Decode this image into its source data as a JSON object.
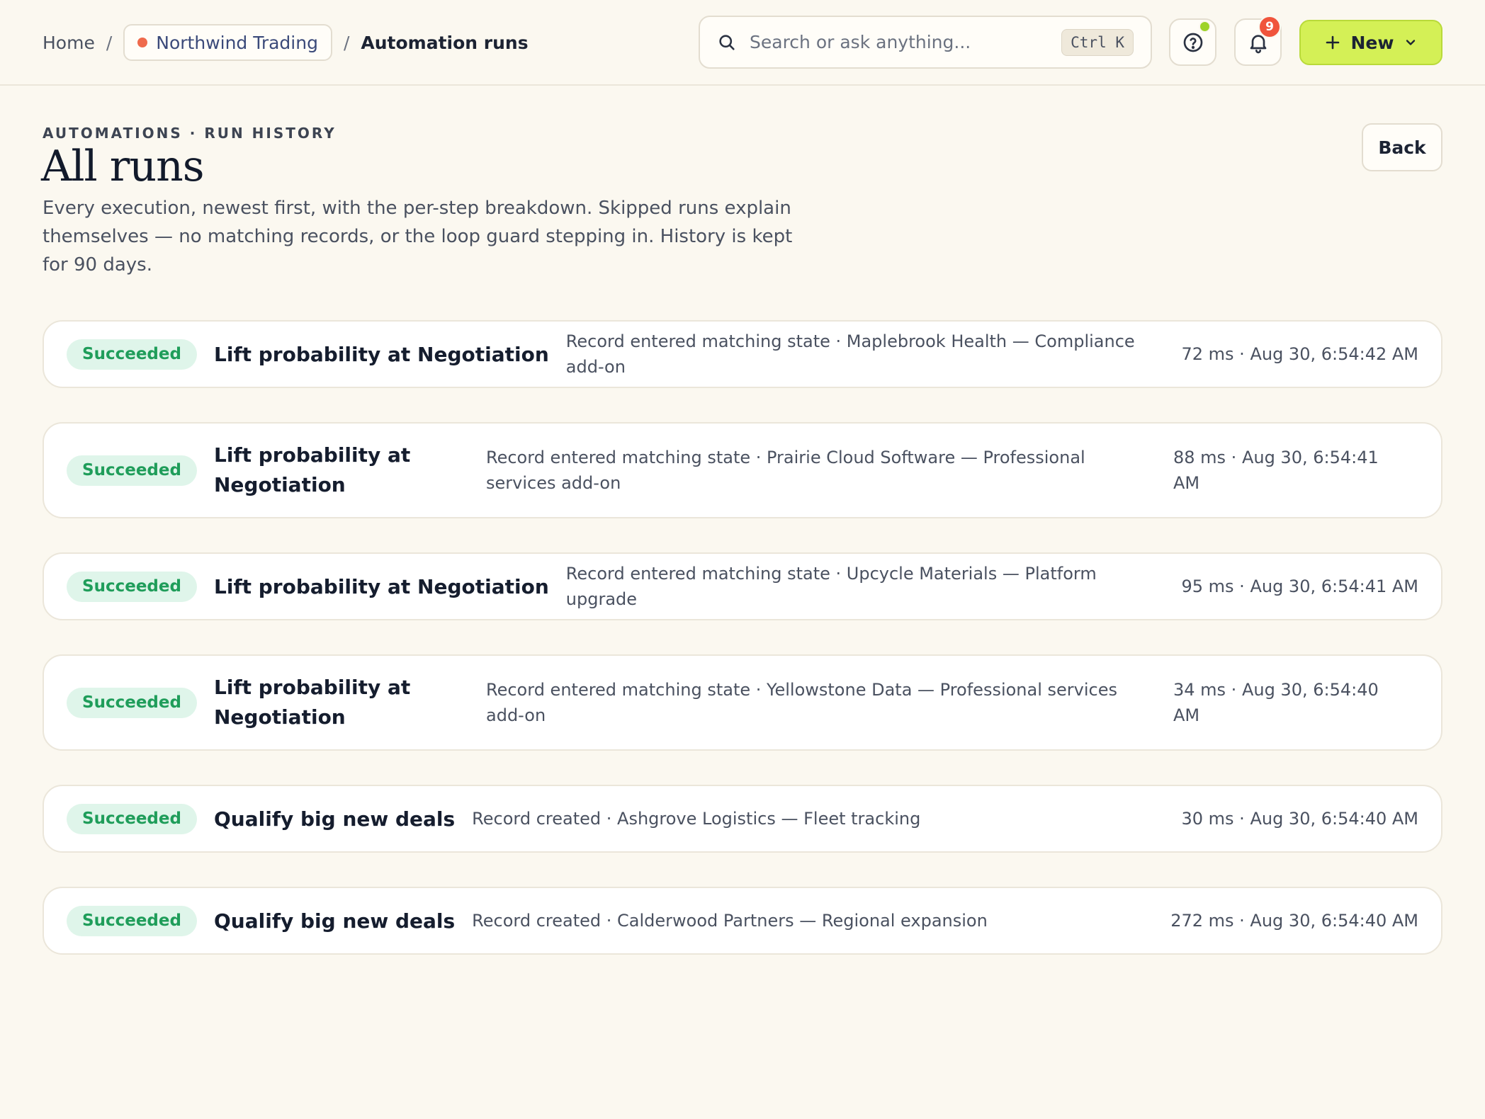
{
  "breadcrumb": {
    "home": "Home",
    "organization": "Northwind Trading",
    "current": "Automation runs",
    "separator": "/"
  },
  "search": {
    "placeholder": "Search or ask anything...",
    "shortcut": "Ctrl K"
  },
  "notifications": {
    "count": "9"
  },
  "new_button": {
    "label": "New"
  },
  "header": {
    "eyebrow": "AUTOMATIONS · RUN HISTORY",
    "title": "All runs",
    "description": "Every execution, newest first, with the per-step breakdown. Skipped runs explain themselves — no matching records, or the loop guard stepping in. History is kept for 90 days.",
    "back_label": "Back"
  },
  "runs": [
    {
      "status": "Succeeded",
      "name": "Lift probability at Negotiation",
      "detail": "Record entered matching state · Maplebrook Health — Compliance add-on",
      "meta": "72 ms · Aug 30, 6:54:42 AM"
    },
    {
      "status": "Succeeded",
      "name": "Lift probability at Negotiation",
      "detail": "Record entered matching state · Prairie Cloud Software — Professional services add-on",
      "meta": "88 ms · Aug 30, 6:54:41 AM"
    },
    {
      "status": "Succeeded",
      "name": "Lift probability at Negotiation",
      "detail": "Record entered matching state · Upcycle Materials — Platform upgrade",
      "meta": "95 ms · Aug 30, 6:54:41 AM"
    },
    {
      "status": "Succeeded",
      "name": "Lift probability at Negotiation",
      "detail": "Record entered matching state · Yellowstone Data — Professional services add-on",
      "meta": "34 ms · Aug 30, 6:54:40 AM"
    },
    {
      "status": "Succeeded",
      "name": "Qualify big new deals",
      "detail": "Record created · Ashgrove Logistics — Fleet tracking",
      "meta": "30 ms · Aug 30, 6:54:40 AM"
    },
    {
      "status": "Succeeded",
      "name": "Qualify big new deals",
      "detail": "Record created · Calderwood Partners — Regional expansion",
      "meta": "272 ms · Aug 30, 6:54:40 AM"
    }
  ],
  "icons": {
    "search": "search-icon",
    "help": "help-circle-icon",
    "bell": "bell-icon",
    "plus": "plus-icon",
    "chevron": "chevron-down-icon"
  },
  "colors": {
    "background": "#fbf8f0",
    "accent": "#d4f056",
    "success_bg": "#dff5ea",
    "success_text": "#1f9d5a",
    "badge_red": "#f0543c",
    "org_dot": "#ef6a4c"
  }
}
